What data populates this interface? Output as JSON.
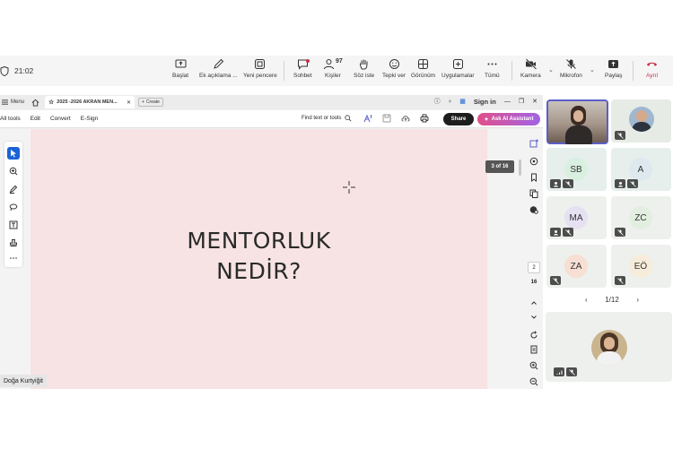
{
  "teams": {
    "time": "21:02",
    "buttons": {
      "share_screen": "Başlat",
      "notes": "Ek açıklama ...",
      "new_window": "Yeni pencere",
      "chat": "Sohbet",
      "people": "Kişiler",
      "people_count": "97",
      "raise_hand": "Söz iste",
      "react": "Tepki ver",
      "view": "Görünüm",
      "apps": "Uygulamalar",
      "more": "Tümü",
      "camera": "Kamera",
      "mic": "Mikrofon",
      "share": "Paylaş",
      "leave": "Ayrıl"
    },
    "colors": {
      "leave": "#c4314b",
      "active_tile_border": "#5b5fc7"
    }
  },
  "pdf": {
    "menu_label": "Menu",
    "tab_title": "2025 -2026 AKRAN MEN...",
    "new_tab_label": "Create",
    "sign_in": "Sign in",
    "menu_items": [
      "All tools",
      "Edit",
      "Convert",
      "E-Sign"
    ],
    "search_label": "Find text or tools",
    "share_label": "Share",
    "ai_label": "Ask AI Assistant",
    "page_indicator": "3 of 16",
    "current_page": "2",
    "total_pages": "16",
    "slide_title_line1": "MENTORLUK",
    "slide_title_line2": "NEDİR?",
    "colors": {
      "slide_bg": "#f7e3e3",
      "select_tool": "#1a62d6"
    }
  },
  "presenter_name": "Doğa Kurtyiğit",
  "participants": {
    "tiles": [
      {
        "initials": "",
        "kind": "video-female"
      },
      {
        "initials": "",
        "kind": "video-male"
      },
      {
        "initials": "SB",
        "avatar_color": "#d9efe0"
      },
      {
        "initials": "A",
        "avatar_color": "#dde9ef"
      },
      {
        "initials": "MA",
        "avatar_color": "#e6e0f3"
      },
      {
        "initials": "ZC",
        "avatar_color": "#e2efe0"
      },
      {
        "initials": "ZA",
        "avatar_color": "#f7dfd3"
      },
      {
        "initials": "EÖ",
        "avatar_color": "#f6ecd9"
      }
    ],
    "pager": "1/12"
  }
}
